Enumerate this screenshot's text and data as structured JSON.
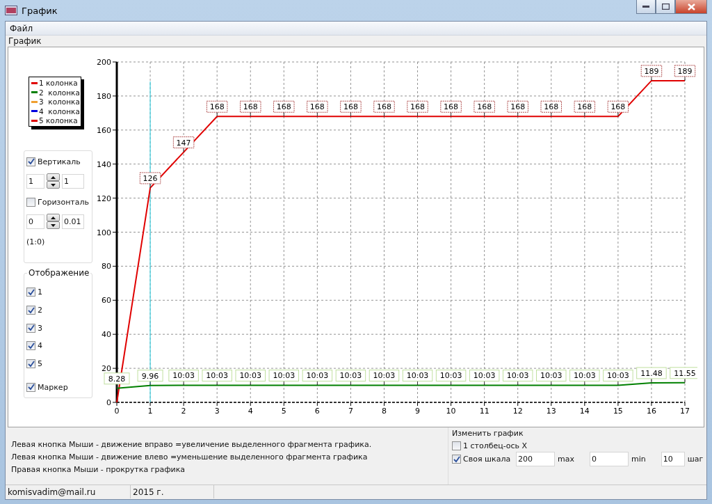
{
  "window": {
    "title": "График"
  },
  "menu": [
    {
      "label": "Файл"
    }
  ],
  "tab": {
    "label": "График"
  },
  "chart_data": {
    "type": "line",
    "grid": true,
    "ref_lines": [
      {
        "axis": "x",
        "value": 1,
        "color": "#40d0e0"
      }
    ],
    "x": [
      0,
      1,
      2,
      3,
      4,
      5,
      6,
      7,
      8,
      9,
      10,
      11,
      12,
      13,
      14,
      15,
      16,
      17
    ],
    "xlim": [
      0,
      17
    ],
    "ylim": [
      0,
      200
    ],
    "xticks": [
      0,
      1,
      2,
      3,
      4,
      5,
      6,
      7,
      8,
      9,
      10,
      11,
      12,
      13,
      14,
      15,
      16,
      17
    ],
    "yticks": [
      0,
      20,
      40,
      60,
      80,
      100,
      120,
      140,
      160,
      180,
      200
    ],
    "series": [
      {
        "name": "1 колонка",
        "color": "#e00000",
        "values": [
          0,
          126,
          147,
          168,
          168,
          168,
          168,
          168,
          168,
          168,
          168,
          168,
          168,
          168,
          168,
          168,
          189,
          189
        ]
      },
      {
        "name": "2  колонка",
        "color": "#008000",
        "values": [
          8.28,
          9.96,
          10.03,
          10.03,
          10.03,
          10.03,
          10.03,
          10.03,
          10.03,
          10.03,
          10.03,
          10.03,
          10.03,
          10.03,
          10.03,
          10.03,
          11.48,
          11.55
        ]
      },
      {
        "name": "3  колонка",
        "color": "#f0a030",
        "values": [
          null,
          null,
          null,
          null,
          null,
          null,
          null,
          null,
          null,
          null,
          null,
          null,
          null,
          null,
          null,
          null,
          null,
          null
        ]
      },
      {
        "name": "4  колонка",
        "color": "#0000e0",
        "values": [
          null,
          null,
          null,
          null,
          null,
          null,
          null,
          null,
          null,
          null,
          null,
          null,
          null,
          null,
          null,
          null,
          null,
          null
        ]
      },
      {
        "name": "5 колонка",
        "color": "#e00000",
        "values": [
          null,
          null,
          null,
          null,
          null,
          null,
          null,
          null,
          null,
          null,
          null,
          null,
          null,
          null,
          null,
          null,
          null,
          null
        ]
      }
    ],
    "value_labels": [
      [
        null,
        "126",
        "147",
        "168",
        "168",
        "168",
        "168",
        "168",
        "168",
        "168",
        "168",
        "168",
        "168",
        "168",
        "168",
        "168",
        "189",
        "189"
      ],
      [
        "8.28",
        "9.96",
        "10:03",
        "10:03",
        "10:03",
        "10:03",
        "10:03",
        "10:03",
        "10:03",
        "10:03",
        "10:03",
        "10:03",
        "10:03",
        "10:03",
        "10:03",
        "10:03",
        "11.48",
        "11.55"
      ]
    ]
  },
  "scale_panel": {
    "vertical": {
      "label": "Вертикаль",
      "checked": true,
      "value": "1",
      "step": "1"
    },
    "horizontal": {
      "label": "Горизонталь",
      "checked": false,
      "value": "0",
      "step": "0.01"
    },
    "ratio": "(1:0)"
  },
  "display_panel": {
    "title": "Отображение",
    "items": [
      {
        "label": "1",
        "checked": true
      },
      {
        "label": "2",
        "checked": true
      },
      {
        "label": "3",
        "checked": true
      },
      {
        "label": "4",
        "checked": true
      },
      {
        "label": "5",
        "checked": true
      }
    ],
    "marker": {
      "label": "Маркер",
      "checked": true
    }
  },
  "hints": [
    "Левая кнопка  Мыши - движение вправо =увеличение выделенного фрагмента графика.",
    "Левая кнопка  Мыши - движение влево =уменьшение выделенного фрагмента графика",
    "Правая кнопка  Мыши - прокрутка графика"
  ],
  "change_chart": {
    "title": "Изменить график",
    "first_column": {
      "label": "1 столбец-ось X",
      "checked": false
    },
    "own_scale": {
      "label": "Своя шкала",
      "checked": true
    },
    "scale_row": [
      {
        "kind": "field",
        "value": "200"
      },
      {
        "kind": "label",
        "text": "max"
      },
      {
        "kind": "field",
        "value": "0"
      },
      {
        "kind": "label",
        "text": "min"
      },
      {
        "kind": "field",
        "value": "10"
      },
      {
        "kind": "label",
        "text": "шаг"
      }
    ]
  },
  "status_bar": [
    "komisvadim@mail.ru",
    "2015 г."
  ]
}
